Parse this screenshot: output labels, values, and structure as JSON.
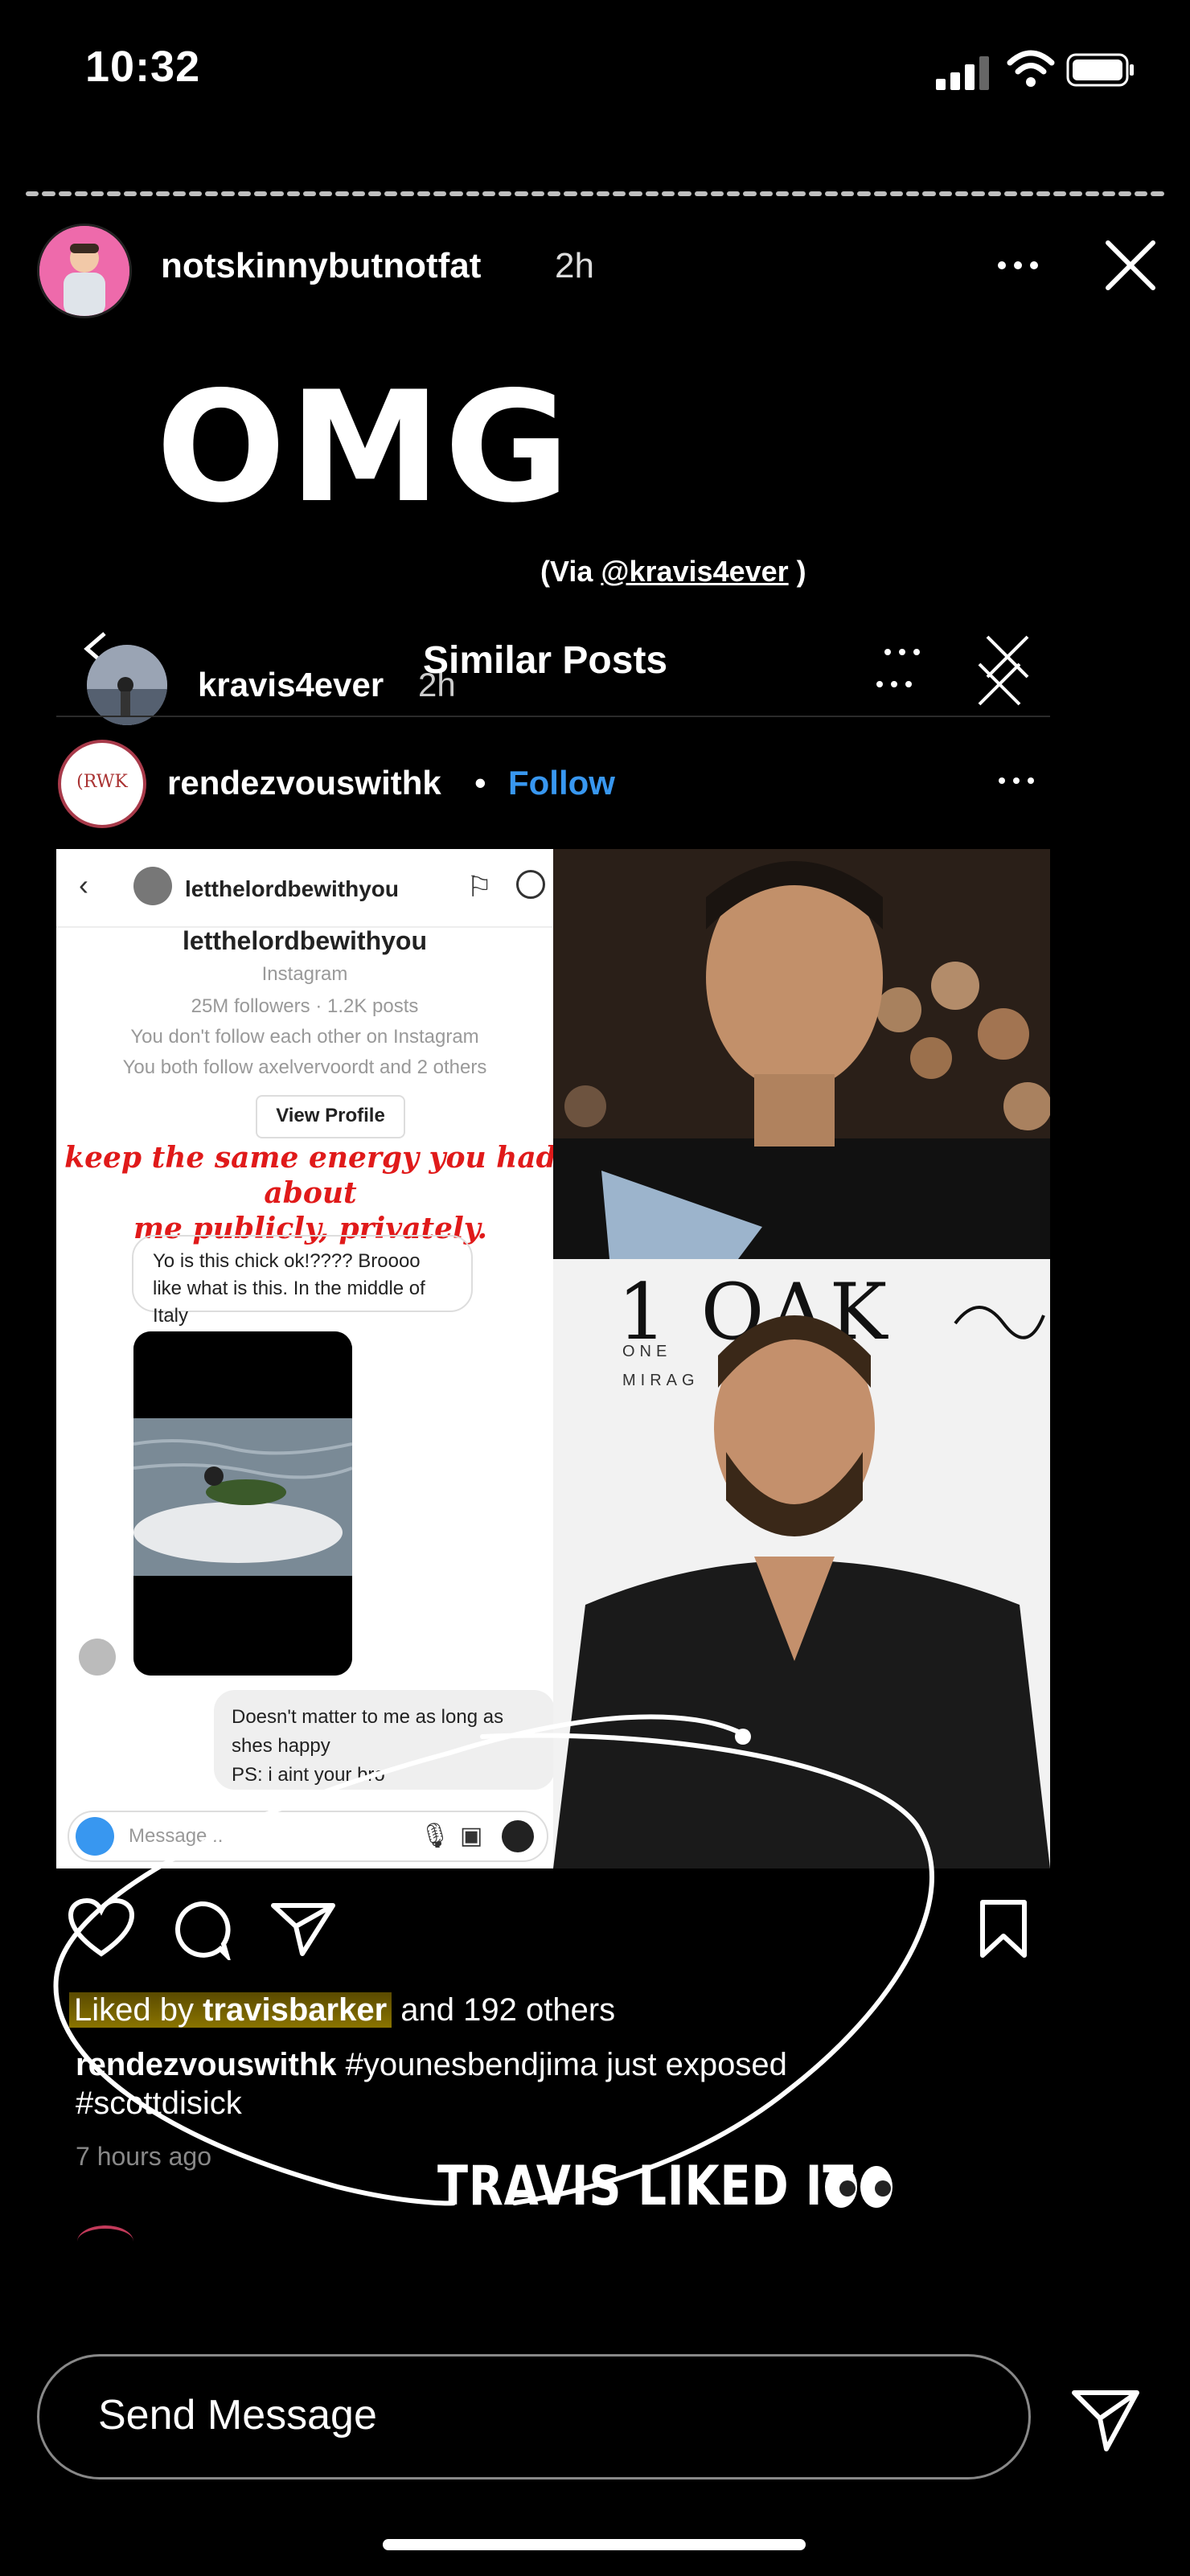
{
  "status_bar": {
    "time": "10:32"
  },
  "story": {
    "username": "notskinnybutnotfat",
    "time": "2h",
    "overlay_text": "OMG",
    "via_prefix": "(Via ",
    "via_handle": "@kravis4ever",
    "via_suffix": " )"
  },
  "embedded_story": {
    "username": "kravis4ever",
    "time": "2h",
    "title": "Similar Posts"
  },
  "post": {
    "username": "rendezvouswithk",
    "separator": "•",
    "follow_label": "Follow",
    "avatar_text": "(RWK",
    "liked_prefix": "Liked by ",
    "liked_user": "travisbarker",
    "liked_suffix": " and 192 others",
    "caption_user": "rendezvouswithk",
    "caption_line1": " #younesbendjima just exposed",
    "caption_line2": "#scottdisick",
    "time_ago": "7 hours ago"
  },
  "dm_screenshot": {
    "title": "letthelordbewithyou",
    "name": "letthelordbewithyou",
    "subtitle": "Instagram",
    "stats": "25M followers · 1.2K posts",
    "relation1": "You don't follow each other on Instagram",
    "relation2": "You both follow axelvervoordt and 2 others",
    "view_profile": "View Profile",
    "red_line1": "keep the same energy you had about",
    "red_line2": "me publicly, privately.",
    "message1": "Yo is this chick ok!???? Broooo like what is this. In the middle of Italy",
    "message2_line1": "Doesn't matter to me as long as",
    "message2_line2": "shes happy",
    "message2_line3": "PS: i aint your bro",
    "input_placeholder": "Message..."
  },
  "photo2": {
    "logo_text": "1 OAK",
    "logo_sub1": "ONE",
    "logo_sub2": "MIRAG"
  },
  "annotation": {
    "text": "TRAVIS LIKED IT"
  },
  "footer": {
    "send_placeholder": "Send Message"
  },
  "colors": {
    "follow": "#3897f0",
    "highlight": "#8a7400",
    "background": "#000000"
  },
  "icons": [
    "signal-icon",
    "wifi-icon",
    "battery-icon",
    "more-icon",
    "close-icon",
    "heart-icon",
    "comment-icon",
    "share-icon",
    "bookmark-icon",
    "direct-send-icon",
    "eyes-emoji"
  ]
}
